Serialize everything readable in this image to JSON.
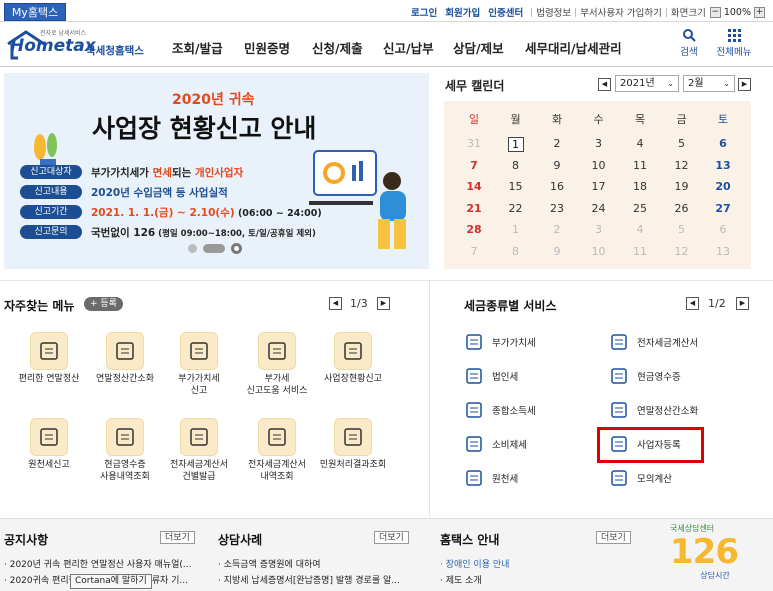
{
  "topbar": {
    "my": "My홈택스",
    "login": "로그인",
    "join": "회원가입",
    "cert": "인증센터",
    "law": "법령정보",
    "dept": "부서사용자 가입하기",
    "screen": "화면크기",
    "zoom_minus": "−",
    "zoom": "100%",
    "zoom_plus": "+"
  },
  "logo": {
    "small": "전자로 납세서비스",
    "main": "Hometax",
    "sub": "국세청홈택스"
  },
  "nav": [
    "조회/발급",
    "민원증명",
    "신청/제출",
    "신고/납부",
    "상담/제보",
    "세무대리/납세관리"
  ],
  "header_icons": {
    "search": "검색",
    "menu": "전체메뉴"
  },
  "banner": {
    "year": "2020년 귀속",
    "title": "사업장 현황신고 안내",
    "rows": [
      {
        "label": "신고대상자",
        "pre": "부가가치세가 ",
        "red1": "면세",
        "mid": "되는 ",
        "red2": "개인사업자"
      },
      {
        "label": "신고내용",
        "text": "2020년 수입금액 등 사업실적"
      },
      {
        "label": "신고기간",
        "red": "2021. 1. 1.(금) ~ 2.10(수)",
        "extra": " (06:00 ~ 24:00)"
      },
      {
        "label": "신고문의",
        "text": "국번없이 126",
        "extra": " (평일 09:00~18:00, 토/일/공휴일 제외)"
      }
    ]
  },
  "calendar": {
    "title": "세무 캘린더",
    "year": "2021년",
    "month": "2월",
    "days": [
      "일",
      "월",
      "화",
      "수",
      "목",
      "금",
      "토"
    ],
    "weeks": [
      [
        "31",
        "1",
        "2",
        "3",
        "4",
        "5",
        "6"
      ],
      [
        "7",
        "8",
        "9",
        "10",
        "11",
        "12",
        "13"
      ],
      [
        "14",
        "15",
        "16",
        "17",
        "18",
        "19",
        "20"
      ],
      [
        "21",
        "22",
        "23",
        "24",
        "25",
        "26",
        "27"
      ],
      [
        "28",
        "1",
        "2",
        "3",
        "4",
        "5",
        "6"
      ],
      [
        "7",
        "8",
        "9",
        "10",
        "11",
        "12",
        "13"
      ]
    ]
  },
  "favorites": {
    "title": "자주찾는 메뉴",
    "add": "+ 등록",
    "page": "1/3",
    "items": [
      "편리한 연말정산",
      "연말정산간소화",
      "부가가치세\n신고",
      "부가세\n신고도움 서비스",
      "사업장현황신고",
      "원천세신고",
      "현금영수증\n사용내역조회",
      "전자세금계산서\n건별발급",
      "전자세금계산서\n내역조회",
      "민원처리결과조회"
    ]
  },
  "taxservice": {
    "title": "세금종류별 서비스",
    "page": "1/2",
    "items": [
      "부가가치세",
      "전자세금계산서",
      "법인세",
      "현금영수증",
      "종합소득세",
      "연말정산간소화",
      "소비제세",
      "사업자등록",
      "원천세",
      "모의계산"
    ]
  },
  "notice": {
    "title": "공지사항",
    "more": "더보기",
    "items": [
      "2020년 귀속 편리한 연말정산 사용자 매뉴얼(...",
      "2020귀속 편리한 연말정산 시스템 오류자 기..."
    ]
  },
  "cases": {
    "title": "상담사례",
    "more": "더보기",
    "items": [
      "소득금액 증명원에 대하여",
      "지방세 납세증명서[완납증명] 발행 경로를 알..."
    ]
  },
  "guide": {
    "title": "홈택스 안내",
    "more": "더보기",
    "items": [
      "장애인 이용 안내",
      "제도 소개"
    ]
  },
  "center": {
    "top": "국세상담센터",
    "num": "126",
    "bottom": "상담시간"
  },
  "tooltip": "Cortana에 말하기"
}
